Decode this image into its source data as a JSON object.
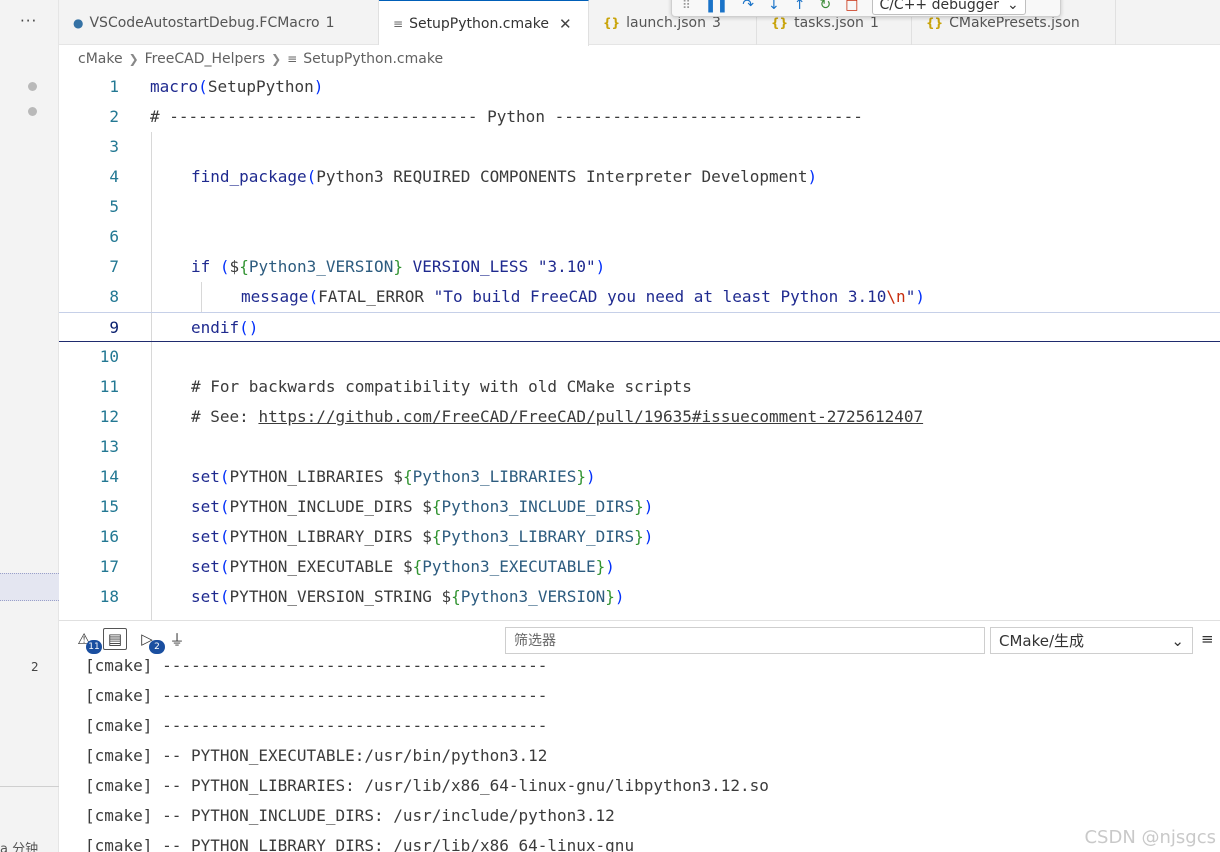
{
  "left_strip": {
    "more": "···",
    "badge": "2",
    "truncated_text": "a 分钟"
  },
  "tabs": [
    {
      "label": "VSCodeAutostartDebug.FCMacro",
      "badge": "1",
      "icon": "python-icon"
    },
    {
      "label": "SetupPython.cmake",
      "icon": "lines-file-icon",
      "close": "✕"
    },
    {
      "label": "launch.json",
      "badge": "3",
      "icon": "json-braces-icon"
    },
    {
      "label": "tasks.json",
      "badge": "1",
      "icon": "json-braces-icon"
    },
    {
      "label": "CMakePresets.json",
      "icon": "json-braces-icon"
    }
  ],
  "debug_toolbar": {
    "config": "C/C++ debugger"
  },
  "breadcrumb": {
    "items": [
      "cMake",
      "FreeCAD_Helpers",
      "SetupPython.cmake"
    ]
  },
  "editor": {
    "current_line": 9,
    "line_numbers": [
      "1",
      "2",
      "3",
      "4",
      "5",
      "6",
      "7",
      "8",
      "9",
      "10",
      "11",
      "12",
      "13",
      "14",
      "15",
      "16",
      "17",
      "18"
    ],
    "code": {
      "l1_fn": "macro",
      "l1_arg": "SetupPython",
      "l2": "# -------------------------------- Python --------------------------------",
      "l4_fn": "find_package",
      "l4_arg": "Python3 REQUIRED COMPONENTS Interpreter Development",
      "l7_kw": "if",
      "l7_var": "Python3_VERSION",
      "l7_op": " VERSION_LESS ",
      "l7_str": "\"3.10\"",
      "l8_fn": "message",
      "l8_arg": "FATAL_ERROR ",
      "l8_str": "\"To build FreeCAD you need at least Python 3.10",
      "l8_esc": "\\n",
      "l8_end": "\"",
      "l9_kw": "endif",
      "l11": "# For backwards compatibility with old CMake scripts",
      "l12_prefix": "# See: ",
      "l12_link": "https://github.com/FreeCAD/FreeCAD/pull/19635#issuecomment-2725612407",
      "sets": [
        {
          "name": "PYTHON_LIBRARIES",
          "var": "Python3_LIBRARIES"
        },
        {
          "name": "PYTHON_INCLUDE_DIRS",
          "var": "Python3_INCLUDE_DIRS"
        },
        {
          "name": "PYTHON_LIBRARY_DIRS",
          "var": "Python3_LIBRARY_DIRS"
        },
        {
          "name": "PYTHON_EXECUTABLE",
          "var": "Python3_EXECUTABLE"
        },
        {
          "name": "PYTHON_VERSION_STRING",
          "var": "Python3_VERSION"
        }
      ],
      "set_kw": "set"
    }
  },
  "panel": {
    "problems_badge": "11",
    "debug_badge": "2",
    "filter_placeholder": "筛选器",
    "channel": "CMake/生成",
    "menu": "≡",
    "output": [
      "[cmake] ----------------------------------------",
      "[cmake] ----------------------------------------",
      "[cmake] ----------------------------------------",
      "[cmake] -- PYTHON_EXECUTABLE:/usr/bin/python3.12",
      "[cmake] -- PYTHON_LIBRARIES: /usr/lib/x86_64-linux-gnu/libpython3.12.so",
      "[cmake] -- PYTHON_INCLUDE_DIRS: /usr/include/python3.12",
      "[cmake] -- PYTHON_LIBRARY_DIRS: /usr/lib/x86_64-linux-gnu"
    ]
  },
  "watermark": "CSDN @njsgcs"
}
